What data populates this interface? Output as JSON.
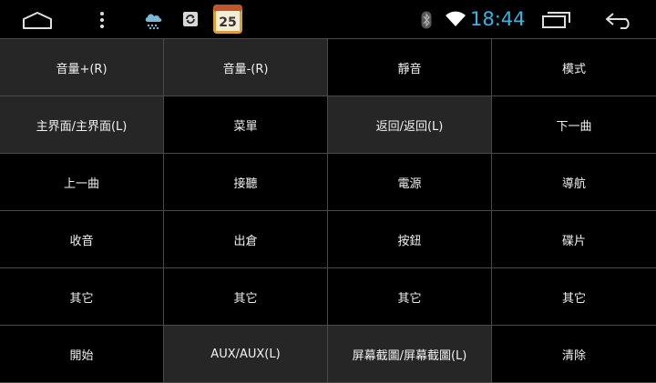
{
  "statusbar": {
    "time": "18:44",
    "calendar_day": "25",
    "clock_color": "#33b5e5"
  },
  "icons": {
    "home": "home-icon",
    "menu": "overflow-menu-icon",
    "weather": "weather-cloud-icon",
    "sync": "sync-icon",
    "calendar": "calendar-icon",
    "bluetooth": "bluetooth-icon",
    "wifi": "wifi-icon",
    "recent": "recent-apps-icon",
    "back": "back-icon"
  },
  "colors": {
    "background": "#000000",
    "cell_dark": "#000000",
    "cell_gray": "#262626",
    "grid_line": "#4a4a4a",
    "text": "#f2f2f2"
  },
  "grid": {
    "rows": [
      [
        "音量+(R)",
        "音量-(R)",
        "靜音",
        "模式"
      ],
      [
        "主界面/主界面(L)",
        "菜單",
        "返回/返回(L)",
        "下一曲"
      ],
      [
        "上一曲",
        "接聽",
        "電源",
        "導航"
      ],
      [
        "收音",
        "出倉",
        "按鈕",
        "碟片"
      ],
      [
        "其它",
        "其它",
        "其它",
        "其它"
      ],
      [
        "開始",
        "AUX/AUX(L)",
        "屏幕截圖/屏幕截圖(L)",
        "清除"
      ]
    ]
  }
}
